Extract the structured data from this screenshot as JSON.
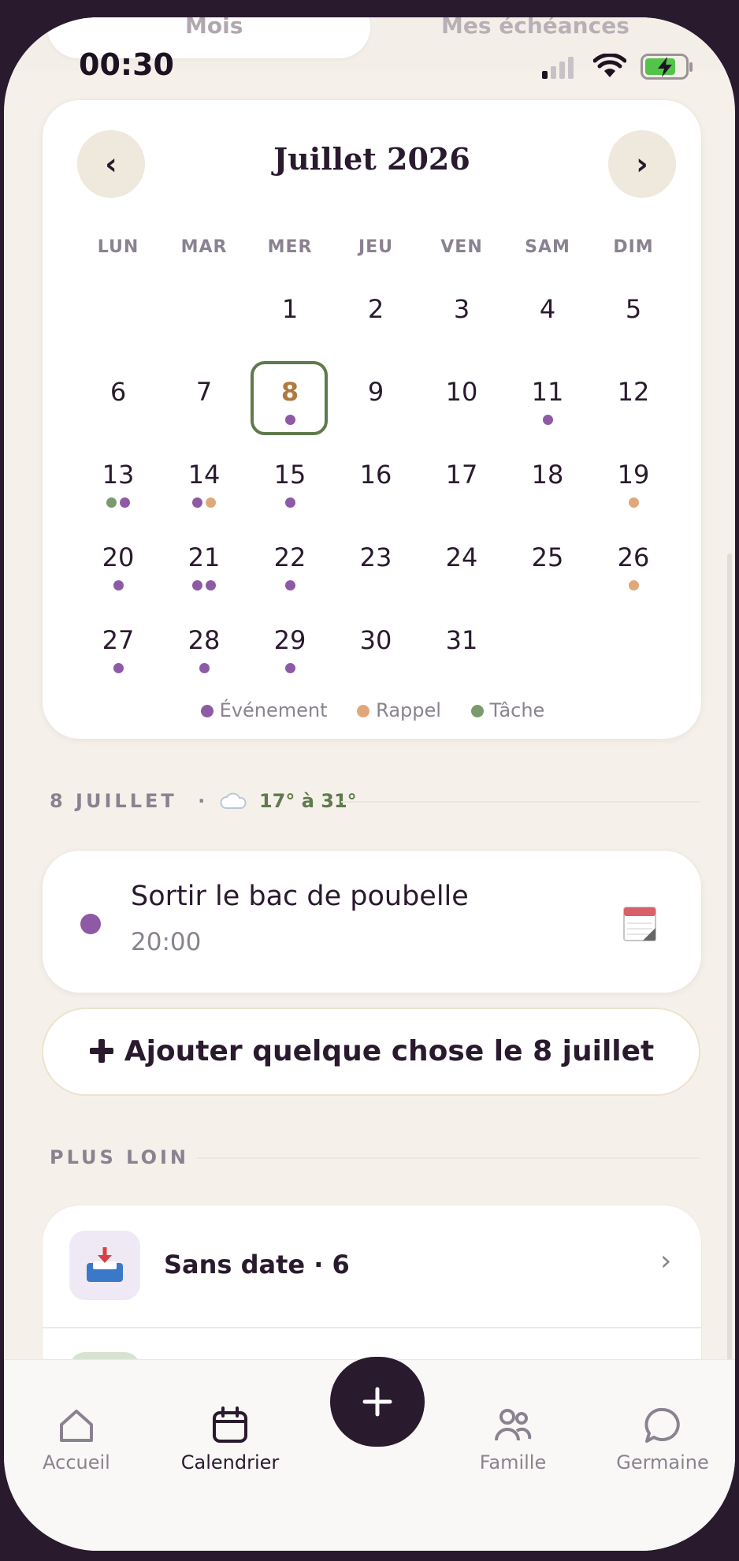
{
  "segments": {
    "left": "Mois",
    "right": "Mes échéances"
  },
  "status": {
    "time": "00:30"
  },
  "calendar": {
    "month_title": "Juillet 2026",
    "prev_label": "‹",
    "next_label": "›",
    "weekdays": [
      "LUN",
      "MAR",
      "MER",
      "JEU",
      "VEN",
      "SAM",
      "DIM"
    ],
    "selected_day": "8",
    "legend": {
      "event": "Événement",
      "reminder": "Rappel",
      "task": "Tâche"
    },
    "colors": {
      "event": "#8e5aa6",
      "reminder": "#e0a878",
      "task": "#7a9b6e",
      "selected_border": "#5f7a4c",
      "selected_text": "#b07a3e"
    }
  },
  "day_section": {
    "header": "8 JUILLET",
    "weather": "17° à 31°"
  },
  "event": {
    "title": "Sortir le bac de poubelle",
    "time": "20:00"
  },
  "add_button": {
    "label": "Ajouter quelque chose le 8 juillet"
  },
  "later": {
    "header": "PLUS LOIN",
    "items": [
      {
        "label": "Sans date · 6"
      }
    ]
  },
  "tabs": {
    "home": "Accueil",
    "calendar": "Calendrier",
    "family": "Famille",
    "assistant": "Germaine"
  }
}
